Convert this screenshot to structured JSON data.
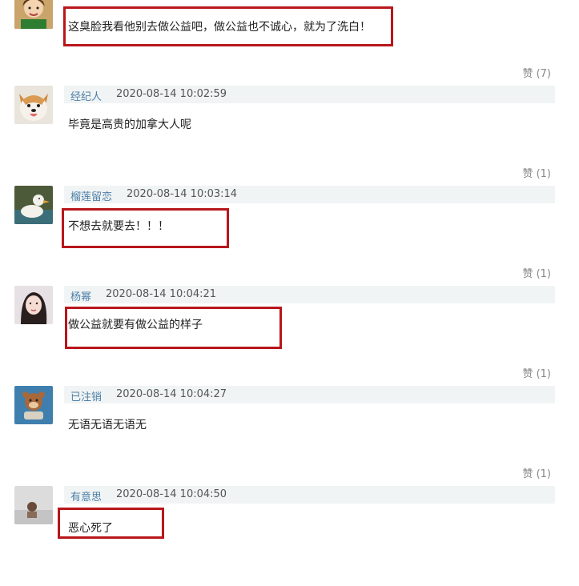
{
  "comments": [
    {
      "user": "",
      "time": "",
      "text": "这臭脸我看他别去做公益吧，做公益也不诚心，就为了洗白！",
      "likes": "赞 (7)"
    },
    {
      "user": "经纪人",
      "time": "2020-08-14 10:02:59",
      "text": "毕竟是高贵的加拿大人呢",
      "likes": "赞 (1)"
    },
    {
      "user": "榴莲留恋",
      "time": "2020-08-14 10:03:14",
      "text": "不想去就要去！！！",
      "likes": "赞 (1)"
    },
    {
      "user": "杨幂",
      "time": "2020-08-14 10:04:21",
      "text": "做公益就要有做公益的样子",
      "likes": "赞 (1)"
    },
    {
      "user": "已注销",
      "time": "2020-08-14 10:04:27",
      "text": "无语无语无语无",
      "likes": "赞 (1)"
    },
    {
      "user": "有意思",
      "time": "2020-08-14 10:04:50",
      "text": "恶心死了",
      "likes": ""
    }
  ],
  "colors": {
    "highlight": "#b8161b",
    "username": "#4c7fa8",
    "meta_bg": "#f1f4f4"
  }
}
